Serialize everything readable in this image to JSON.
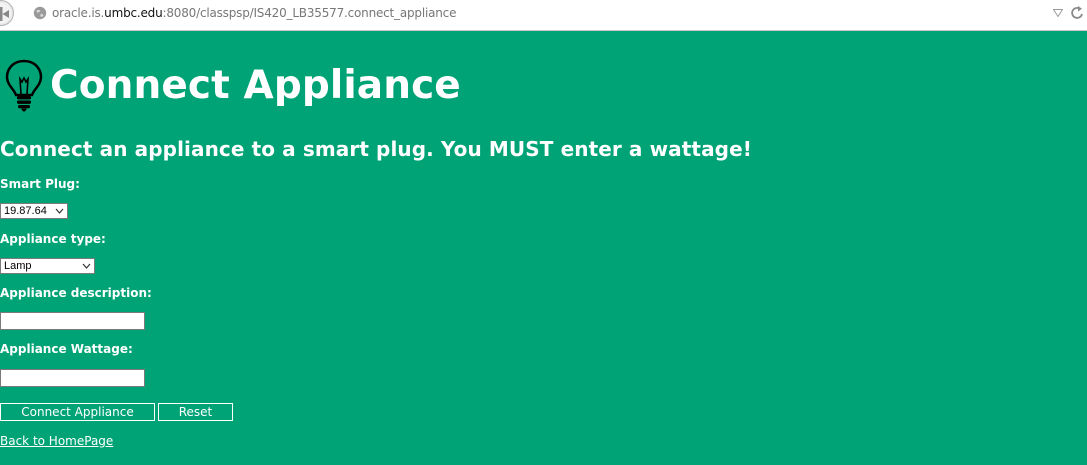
{
  "browser": {
    "url_prefix": "oracle.is.",
    "url_host": "umbc.edu",
    "url_suffix": ":8080/classpsp/IS420_LB35577.connect_appliance",
    "icons": [
      "back-arrow-icon",
      "globe-icon",
      "dropdown-arrow-icon",
      "reload-icon"
    ]
  },
  "page": {
    "heading": "Connect Appliance",
    "heading_icon": "lightbulb-icon",
    "subtitle": "Connect an appliance to a smart plug. You MUST enter a wattage!",
    "background_color": "#00a375",
    "text_color": "#ffffff"
  },
  "form": {
    "smart_plug": {
      "label": "Smart Plug:",
      "selected": "19.87.64"
    },
    "appliance_type": {
      "label": "Appliance type:",
      "selected": "Lamp"
    },
    "appliance_description": {
      "label": "Appliance description:",
      "value": ""
    },
    "appliance_wattage": {
      "label": "Appliance Wattage:",
      "value": ""
    },
    "submit_label": "Connect Appliance",
    "reset_label": "Reset"
  },
  "links": {
    "back_home": "Back to HomePage"
  }
}
